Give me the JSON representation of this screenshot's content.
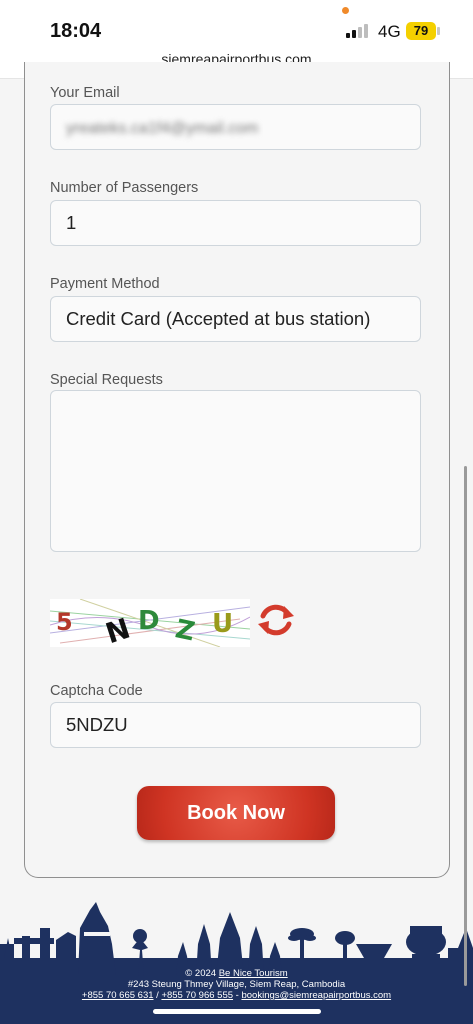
{
  "status": {
    "time": "18:04",
    "network": "4G",
    "battery": "79"
  },
  "browser": {
    "url": "siemreapairportbus.com"
  },
  "form": {
    "email_label": "Your Email",
    "email_value": "yreateks.ca1f4@ymail.com",
    "passengers_label": "Number of Passengers",
    "passengers_value": "1",
    "payment_label": "Payment Method",
    "payment_value": "Credit Card (Accepted at bus station)",
    "requests_label": "Special Requests",
    "requests_value": "",
    "captcha_image_text": "5NDZU",
    "captcha_label": "Captcha Code",
    "captcha_value": "5NDZU",
    "submit_label": "Book Now"
  },
  "footer": {
    "copyright": "© 2024",
    "company": "Be Nice Tourism",
    "address": "#243 Steung Thmey Village, Siem Reap, Cambodia",
    "phone1": "+855 70 665 631",
    "separator": "/",
    "phone2": "+855 70 966 555",
    "dash": "-",
    "email": "bookings@siemreapairportbus.com"
  },
  "colors": {
    "accent_red": "#cf3423",
    "footer_navy": "#1e3160",
    "field_border": "#cfd6dc"
  }
}
